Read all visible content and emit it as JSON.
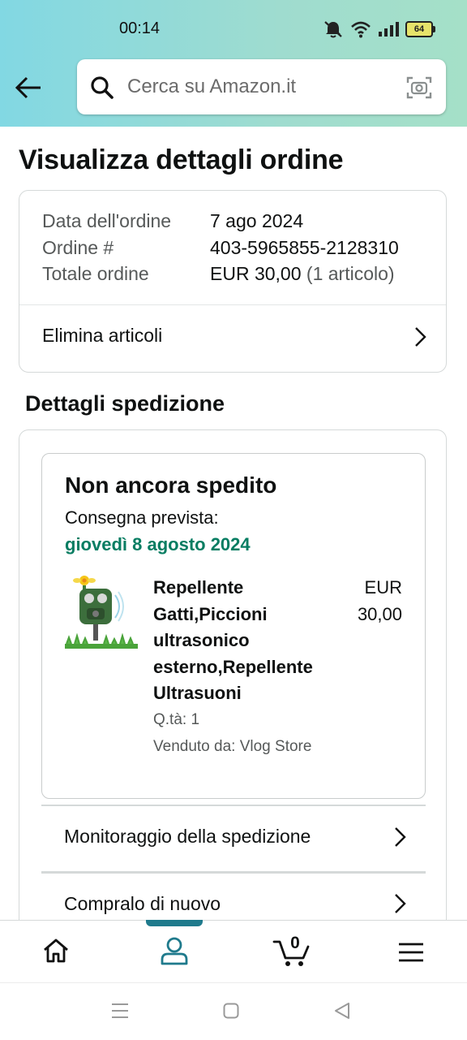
{
  "status_bar": {
    "time": "00:14",
    "battery_level": "64",
    "icons": [
      "mute-icon",
      "wifi-icon",
      "signal-icon",
      "battery-icon"
    ]
  },
  "header": {
    "search_placeholder": "Cerca su Amazon.it",
    "icons": [
      "back-arrow-icon",
      "search-icon",
      "camera-scan-icon"
    ]
  },
  "page": {
    "title": "Visualizza dettagli ordine"
  },
  "order_summary": {
    "date_label": "Data dell'ordine",
    "date_value": "7 ago 2024",
    "number_label": "Ordine #",
    "number_value": "403-5965855-2128310",
    "total_label": "Totale ordine",
    "total_value": "EUR 30,00",
    "total_items": "(1 articolo)",
    "remove_items_label": "Elimina articoli"
  },
  "shipping": {
    "section_title": "Dettagli spedizione",
    "status": "Non ancora spedito",
    "delivery_label": "Consegna prevista:",
    "delivery_date": "giovedì 8 agosto 2024",
    "accent_color": "#067d62",
    "product": {
      "title": "Repellente Gatti,Piccioni ultrasonico esterno,Repellente Ultrasuoni",
      "price": "EUR 30,00",
      "quantity": "Q.tà: 1",
      "seller": "Venduto da: Vlog Store"
    },
    "actions": {
      "track_label": "Monitoraggio della spedizione",
      "buy_again_label": "Compralo di nuovo"
    }
  },
  "bottom_nav": {
    "items": [
      "home-icon",
      "account-icon",
      "cart-icon",
      "menu-icon"
    ],
    "active": "account-icon",
    "cart_count": "0",
    "active_color": "#1f7a8c"
  },
  "system_nav": {
    "items": [
      "recents-icon",
      "home-square-icon",
      "back-triangle-icon"
    ]
  }
}
